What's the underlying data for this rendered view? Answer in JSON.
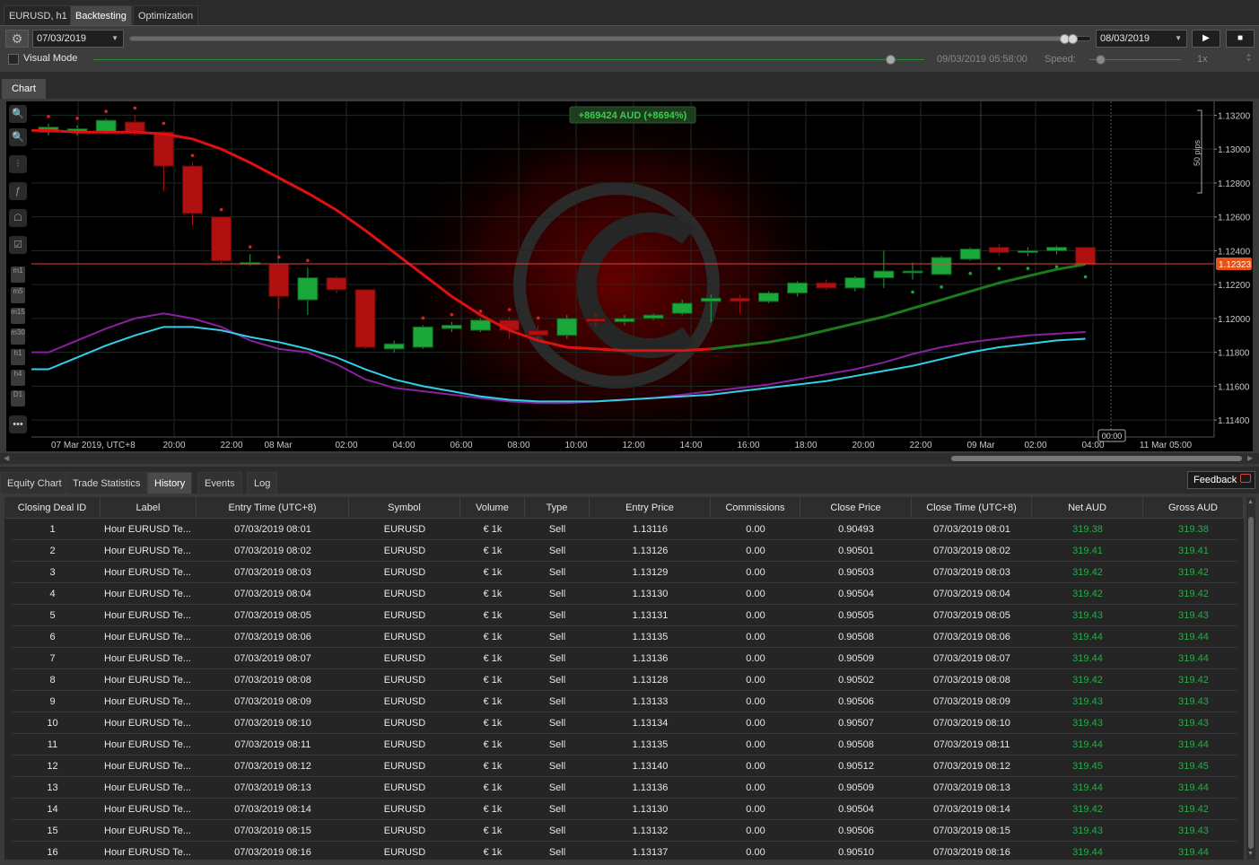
{
  "top_tabs": [
    {
      "label": "EURUSD, h1",
      "active": false
    },
    {
      "label": "Backtesting",
      "active": true
    },
    {
      "label": "Optimization",
      "active": false
    }
  ],
  "toolbar": {
    "start_date": "07/03/2019",
    "end_date": "08/03/2019",
    "visual_mode_label": "Visual Mode",
    "visual_mode_checked": false,
    "current_time": "09/03/2019 05:58:00",
    "speed_label": "Speed:",
    "speed_value": "1x"
  },
  "chart_tab": "Chart",
  "chart": {
    "equity_badge": "+869424 AUD (+8694%)",
    "pips_label": "50 pips",
    "price_labels": [
      "1.13200",
      "1.13000",
      "1.12800",
      "1.12600",
      "1.12400",
      "1.12200",
      "1.12000",
      "1.11800",
      "1.11600",
      "1.11400"
    ],
    "current_price": "1.12323",
    "time_labels": [
      "07 Mar 2019, UTC+8",
      "20:00",
      "22:00",
      "08 Mar",
      "02:00",
      "04:00",
      "06:00",
      "08:00",
      "10:00",
      "12:00",
      "14:00",
      "16:00",
      "18:00",
      "20:00",
      "22:00",
      "09 Mar",
      "02:00",
      "04:00",
      "11 Mar 05:00"
    ],
    "cursor_time": "00:00",
    "timeframes": [
      "m1",
      "m5",
      "m15",
      "m30",
      "h1",
      "h4",
      "D1"
    ],
    "colors": {
      "bull": "#1aa83a",
      "bear": "#b01010",
      "ma_red": "#e01010",
      "ma_green": "#1c7a1c",
      "band_cyan": "#30d0e8",
      "band_purple": "#8a1fa0"
    }
  },
  "bottom_tabs": [
    {
      "label": "Equity Chart",
      "active": false
    },
    {
      "label": "Trade Statistics",
      "active": false
    },
    {
      "label": "History",
      "active": true
    },
    {
      "label": "Events",
      "active": false
    },
    {
      "label": "Log",
      "active": false
    }
  ],
  "feedback_label": "Feedback",
  "history": {
    "columns": [
      "Closing Deal ID",
      "Label",
      "Entry Time (UTC+8)",
      "Symbol",
      "Volume",
      "Type",
      "Entry Price",
      "Commissions",
      "Close Price",
      "Close Time (UTC+8)",
      "Net AUD",
      "Gross AUD"
    ],
    "rows": [
      [
        "1",
        "Hour EURUSD Te...",
        "07/03/2019 08:01",
        "EURUSD",
        "€ 1k",
        "Sell",
        "1.13116",
        "0.00",
        "0.90493",
        "07/03/2019 08:01",
        "319.38",
        "319.38"
      ],
      [
        "2",
        "Hour EURUSD Te...",
        "07/03/2019 08:02",
        "EURUSD",
        "€ 1k",
        "Sell",
        "1.13126",
        "0.00",
        "0.90501",
        "07/03/2019 08:02",
        "319.41",
        "319.41"
      ],
      [
        "3",
        "Hour EURUSD Te...",
        "07/03/2019 08:03",
        "EURUSD",
        "€ 1k",
        "Sell",
        "1.13129",
        "0.00",
        "0.90503",
        "07/03/2019 08:03",
        "319.42",
        "319.42"
      ],
      [
        "4",
        "Hour EURUSD Te...",
        "07/03/2019 08:04",
        "EURUSD",
        "€ 1k",
        "Sell",
        "1.13130",
        "0.00",
        "0.90504",
        "07/03/2019 08:04",
        "319.42",
        "319.42"
      ],
      [
        "5",
        "Hour EURUSD Te...",
        "07/03/2019 08:05",
        "EURUSD",
        "€ 1k",
        "Sell",
        "1.13131",
        "0.00",
        "0.90505",
        "07/03/2019 08:05",
        "319.43",
        "319.43"
      ],
      [
        "6",
        "Hour EURUSD Te...",
        "07/03/2019 08:06",
        "EURUSD",
        "€ 1k",
        "Sell",
        "1.13135",
        "0.00",
        "0.90508",
        "07/03/2019 08:06",
        "319.44",
        "319.44"
      ],
      [
        "7",
        "Hour EURUSD Te...",
        "07/03/2019 08:07",
        "EURUSD",
        "€ 1k",
        "Sell",
        "1.13136",
        "0.00",
        "0.90509",
        "07/03/2019 08:07",
        "319.44",
        "319.44"
      ],
      [
        "8",
        "Hour EURUSD Te...",
        "07/03/2019 08:08",
        "EURUSD",
        "€ 1k",
        "Sell",
        "1.13128",
        "0.00",
        "0.90502",
        "07/03/2019 08:08",
        "319.42",
        "319.42"
      ],
      [
        "9",
        "Hour EURUSD Te...",
        "07/03/2019 08:09",
        "EURUSD",
        "€ 1k",
        "Sell",
        "1.13133",
        "0.00",
        "0.90506",
        "07/03/2019 08:09",
        "319.43",
        "319.43"
      ],
      [
        "10",
        "Hour EURUSD Te...",
        "07/03/2019 08:10",
        "EURUSD",
        "€ 1k",
        "Sell",
        "1.13134",
        "0.00",
        "0.90507",
        "07/03/2019 08:10",
        "319.43",
        "319.43"
      ],
      [
        "11",
        "Hour EURUSD Te...",
        "07/03/2019 08:11",
        "EURUSD",
        "€ 1k",
        "Sell",
        "1.13135",
        "0.00",
        "0.90508",
        "07/03/2019 08:11",
        "319.44",
        "319.44"
      ],
      [
        "12",
        "Hour EURUSD Te...",
        "07/03/2019 08:12",
        "EURUSD",
        "€ 1k",
        "Sell",
        "1.13140",
        "0.00",
        "0.90512",
        "07/03/2019 08:12",
        "319.45",
        "319.45"
      ],
      [
        "13",
        "Hour EURUSD Te...",
        "07/03/2019 08:13",
        "EURUSD",
        "€ 1k",
        "Sell",
        "1.13136",
        "0.00",
        "0.90509",
        "07/03/2019 08:13",
        "319.44",
        "319.44"
      ],
      [
        "14",
        "Hour EURUSD Te...",
        "07/03/2019 08:14",
        "EURUSD",
        "€ 1k",
        "Sell",
        "1.13130",
        "0.00",
        "0.90504",
        "07/03/2019 08:14",
        "319.42",
        "319.42"
      ],
      [
        "15",
        "Hour EURUSD Te...",
        "07/03/2019 08:15",
        "EURUSD",
        "€ 1k",
        "Sell",
        "1.13132",
        "0.00",
        "0.90506",
        "07/03/2019 08:15",
        "319.43",
        "319.43"
      ],
      [
        "16",
        "Hour EURUSD Te...",
        "07/03/2019 08:16",
        "EURUSD",
        "€ 1k",
        "Sell",
        "1.13137",
        "0.00",
        "0.90510",
        "07/03/2019 08:16",
        "319.44",
        "319.44"
      ]
    ]
  },
  "chart_data": {
    "type": "candlestick",
    "title": "EURUSD, h1",
    "ylim": [
      1.113,
      1.1325
    ],
    "candles": [
      {
        "o": 1.131,
        "c": 1.1313,
        "h": 1.1315,
        "l": 1.1308
      },
      {
        "o": 1.131,
        "c": 1.1312,
        "h": 1.1314,
        "l": 1.1308
      },
      {
        "o": 1.131,
        "c": 1.1317,
        "h": 1.1318,
        "l": 1.1309
      },
      {
        "o": 1.1316,
        "c": 1.131,
        "h": 1.132,
        "l": 1.1308
      },
      {
        "o": 1.131,
        "c": 1.129,
        "h": 1.1311,
        "l": 1.1275
      },
      {
        "o": 1.129,
        "c": 1.1262,
        "h": 1.1292,
        "l": 1.1255
      },
      {
        "o": 1.126,
        "c": 1.1234,
        "h": 1.126,
        "l": 1.1232
      },
      {
        "o": 1.1233,
        "c": 1.1233,
        "h": 1.1238,
        "l": 1.1231
      },
      {
        "o": 1.1232,
        "c": 1.1213,
        "h": 1.1232,
        "l": 1.1206
      },
      {
        "o": 1.1211,
        "c": 1.1224,
        "h": 1.123,
        "l": 1.1202
      },
      {
        "o": 1.1224,
        "c": 1.1217,
        "h": 1.1225,
        "l": 1.1215
      },
      {
        "o": 1.1217,
        "c": 1.1183,
        "h": 1.1217,
        "l": 1.1182
      },
      {
        "o": 1.1182,
        "c": 1.1185,
        "h": 1.1187,
        "l": 1.118
      },
      {
        "o": 1.1183,
        "c": 1.1195,
        "h": 1.1196,
        "l": 1.1182
      },
      {
        "o": 1.1194,
        "c": 1.1196,
        "h": 1.1198,
        "l": 1.1192
      },
      {
        "o": 1.1193,
        "c": 1.1199,
        "h": 1.12,
        "l": 1.1192
      },
      {
        "o": 1.1199,
        "c": 1.1193,
        "h": 1.1201,
        "l": 1.1188
      },
      {
        "o": 1.1193,
        "c": 1.119,
        "h": 1.1196,
        "l": 1.1186
      },
      {
        "o": 1.119,
        "c": 1.12,
        "h": 1.1202,
        "l": 1.1188
      },
      {
        "o": 1.12,
        "c": 1.1198,
        "h": 1.1203,
        "l": 1.1195
      },
      {
        "o": 1.1198,
        "c": 1.12,
        "h": 1.1202,
        "l": 1.1196
      },
      {
        "o": 1.12,
        "c": 1.1202,
        "h": 1.1203,
        "l": 1.1199
      },
      {
        "o": 1.1203,
        "c": 1.1209,
        "h": 1.1211,
        "l": 1.1202
      },
      {
        "o": 1.121,
        "c": 1.1212,
        "h": 1.1214,
        "l": 1.1198
      },
      {
        "o": 1.1212,
        "c": 1.121,
        "h": 1.1214,
        "l": 1.1203
      },
      {
        "o": 1.121,
        "c": 1.1215,
        "h": 1.1216,
        "l": 1.1209
      },
      {
        "o": 1.1215,
        "c": 1.1221,
        "h": 1.1222,
        "l": 1.1213
      },
      {
        "o": 1.1221,
        "c": 1.1218,
        "h": 1.1223,
        "l": 1.1217
      },
      {
        "o": 1.1218,
        "c": 1.1224,
        "h": 1.1225,
        "l": 1.1216
      },
      {
        "o": 1.1224,
        "c": 1.1228,
        "h": 1.124,
        "l": 1.1218
      },
      {
        "o": 1.1228,
        "c": 1.1228,
        "h": 1.1233,
        "l": 1.1223
      },
      {
        "o": 1.1226,
        "c": 1.1236,
        "h": 1.1237,
        "l": 1.1226
      },
      {
        "o": 1.1235,
        "c": 1.1241,
        "h": 1.1242,
        "l": 1.1234
      },
      {
        "o": 1.1242,
        "c": 1.1239,
        "h": 1.1244,
        "l": 1.1237
      },
      {
        "o": 1.124,
        "c": 1.124,
        "h": 1.1242,
        "l": 1.1237
      },
      {
        "o": 1.124,
        "c": 1.1242,
        "h": 1.1243,
        "l": 1.1238
      },
      {
        "o": 1.1242,
        "c": 1.1232,
        "h": 1.1242,
        "l": 1.1232
      }
    ],
    "series": [
      {
        "name": "MA",
        "values": [
          1.1311,
          1.131,
          1.131,
          1.131,
          1.1309,
          1.1306,
          1.13,
          1.1292,
          1.1283,
          1.1274,
          1.1264,
          1.1252,
          1.1239,
          1.1226,
          1.1213,
          1.1202,
          1.1193,
          1.1187,
          1.1183,
          1.1182,
          1.1181,
          1.1181,
          1.1181,
          1.1182,
          1.1184,
          1.1186,
          1.1189,
          1.1193,
          1.1197,
          1.1201,
          1.1206,
          1.1211,
          1.1216,
          1.1221,
          1.1225,
          1.1229,
          1.1232
        ]
      },
      {
        "name": "Band cyan",
        "values": [
          1.117,
          1.1177,
          1.1184,
          1.119,
          1.1195,
          1.1195,
          1.1193,
          1.1189,
          1.1186,
          1.1182,
          1.1177,
          1.117,
          1.1164,
          1.116,
          1.1157,
          1.1154,
          1.1152,
          1.1151,
          1.1151,
          1.1151,
          1.1152,
          1.1153,
          1.1154,
          1.1155,
          1.1157,
          1.1159,
          1.1161,
          1.1163,
          1.1166,
          1.1169,
          1.1172,
          1.1176,
          1.118,
          1.1183,
          1.1185,
          1.1187,
          1.1188
        ]
      },
      {
        "name": "Band purple",
        "values": [
          1.118,
          1.1187,
          1.1194,
          1.12,
          1.1203,
          1.12,
          1.1195,
          1.1187,
          1.1182,
          1.118,
          1.1173,
          1.1164,
          1.1159,
          1.1157,
          1.1155,
          1.1153,
          1.1151,
          1.115,
          1.115,
          1.1151,
          1.1152,
          1.1153,
          1.1155,
          1.1157,
          1.1159,
          1.1161,
          1.1164,
          1.1167,
          1.117,
          1.1174,
          1.1179,
          1.1183,
          1.1186,
          1.1188,
          1.119,
          1.1191,
          1.1192
        ]
      }
    ],
    "current_price": 1.12323
  }
}
